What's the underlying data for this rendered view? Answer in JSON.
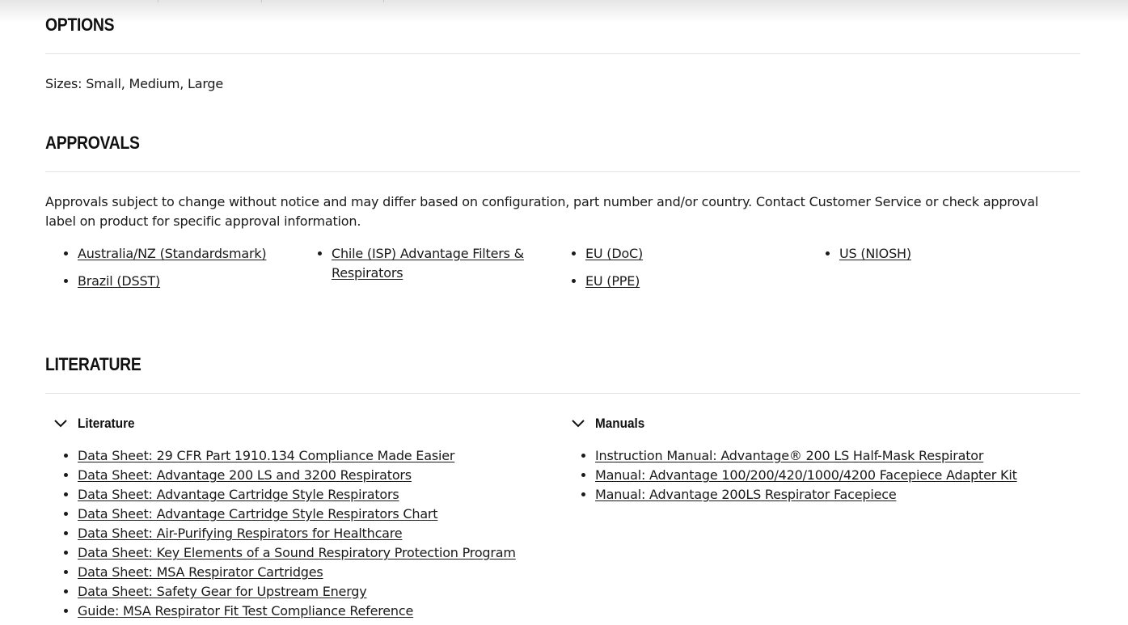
{
  "options": {
    "title": "OPTIONS",
    "sizes_text": "Sizes: Small, Medium, Large"
  },
  "approvals": {
    "title": "APPROVALS",
    "description": "Approvals subject to change without notice and may differ based on configuration, part number and/or country. Contact Customer Service or check approval label on product for specific approval information.",
    "columns": [
      [
        "Australia/NZ (Standardsmark)",
        "Brazil (DSST)"
      ],
      [
        "Chile (ISP) Advantage Filters & Respirators"
      ],
      [
        "EU (DoC)",
        "EU (PPE)"
      ],
      [
        "US (NIOSH)"
      ]
    ]
  },
  "literature": {
    "title": "LITERATURE",
    "groups": [
      {
        "title": "Literature",
        "icon": "chevron-down-icon",
        "items": [
          "Data Sheet: 29 CFR Part 1910.134 Compliance Made Easier",
          "Data Sheet: Advantage 200 LS and 3200 Respirators",
          "Data Sheet: Advantage Cartridge Style Respirators",
          "Data Sheet: Advantage Cartridge Style Respirators Chart",
          "Data Sheet: Air-Purifying Respirators for Healthcare",
          "Data Sheet: Key Elements of a Sound Respiratory Protection Program",
          "Data Sheet: MSA Respirator Cartridges",
          "Data Sheet: Safety Gear for Upstream Energy",
          "Guide: MSA Respirator Fit Test Compliance Reference"
        ]
      },
      {
        "title": "Manuals",
        "icon": "chevron-down-icon",
        "items": [
          "Instruction Manual: Advantage® 200 LS Half-Mask Respirator",
          "Manual: Advantage 100/200/420/1000/4200 Facepiece Adapter Kit",
          "Manual: Advantage 200LS Respirator Facepiece"
        ]
      }
    ]
  }
}
